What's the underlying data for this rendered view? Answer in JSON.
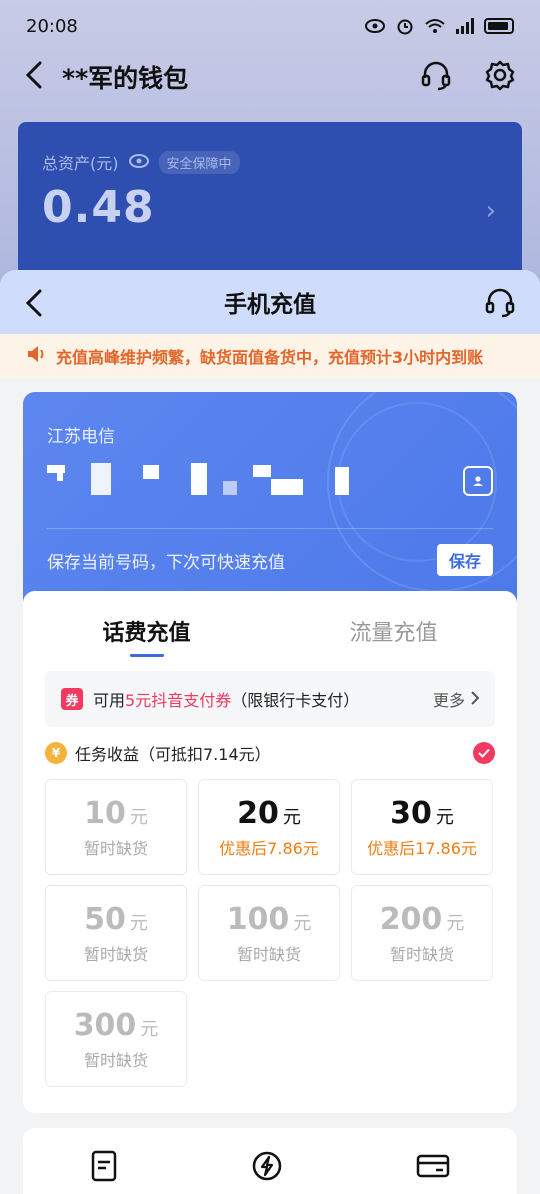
{
  "status": {
    "time": "20:08"
  },
  "wallet": {
    "title": "**军的钱包",
    "asset_label": "总资产(元)",
    "safe_badge": "安全保障中",
    "asset_value": "0.48"
  },
  "sheet": {
    "title": "手机充值",
    "notice": "充值高峰维护频繁，缺货面值备货中，充值预计3小时内到账"
  },
  "number_card": {
    "carrier": "江苏电信",
    "save_hint": "保存当前号码，下次可快速充值",
    "save_label": "保存"
  },
  "tabs": [
    {
      "label": "话费充值",
      "active": true
    },
    {
      "label": "流量充值",
      "active": false
    }
  ],
  "coupon": {
    "tag": "券",
    "prefix": "可用",
    "highlight": "5元抖音支付券",
    "suffix": "（限银行卡支付）",
    "more_label": "更多"
  },
  "task": {
    "coin": "¥",
    "text": "任务收益（可抵扣7.14元）"
  },
  "amounts": [
    {
      "amount": "10",
      "unit": "元",
      "sub": "暂时缺货",
      "available": false
    },
    {
      "amount": "20",
      "unit": "元",
      "sub": "优惠后7.86元",
      "available": true
    },
    {
      "amount": "30",
      "unit": "元",
      "sub": "优惠后17.86元",
      "available": true
    },
    {
      "amount": "50",
      "unit": "元",
      "sub": "暂时缺货",
      "available": false
    },
    {
      "amount": "100",
      "unit": "元",
      "sub": "暂时缺货",
      "available": false
    },
    {
      "amount": "200",
      "unit": "元",
      "sub": "暂时缺货",
      "available": false
    },
    {
      "amount": "300",
      "unit": "元",
      "sub": "暂时缺货",
      "available": false
    }
  ],
  "colors": {
    "accent": "#3d6ae3",
    "highlight": "#f03a5f",
    "price": "#f07d12",
    "notice": "#e5662b"
  }
}
